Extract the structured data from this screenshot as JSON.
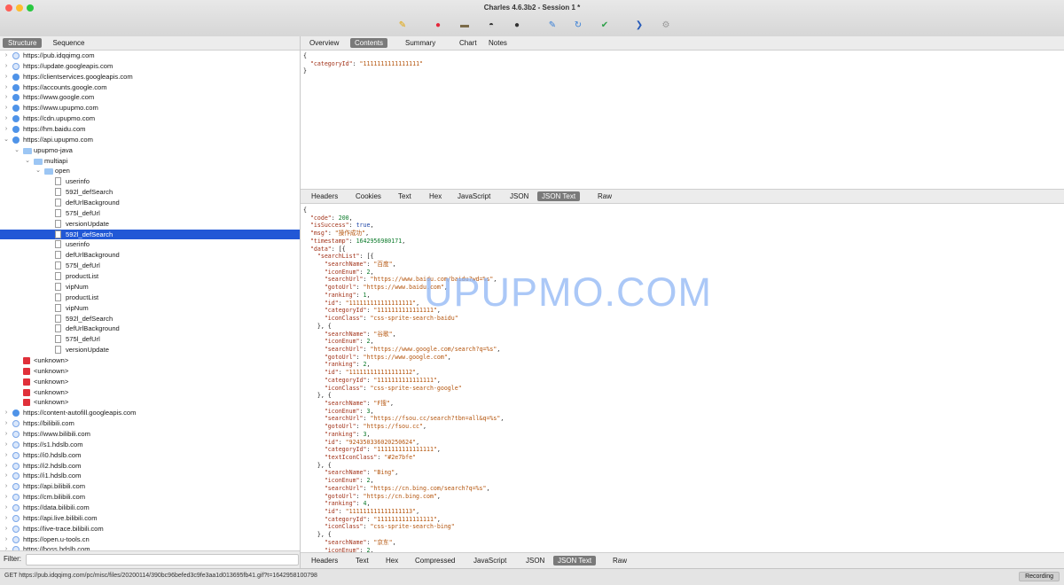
{
  "window": {
    "title": "Charles 4.6.3b2 - Session 1 *"
  },
  "toolbar": [
    {
      "name": "broom-icon",
      "glyph": "✎",
      "color": "#e2a400"
    },
    {
      "name": "record-icon",
      "glyph": "●",
      "color": "#e5273b"
    },
    {
      "name": "throttle-icon",
      "glyph": "▬",
      "color": "#7a6a48"
    },
    {
      "name": "turtle-icon",
      "glyph": "◓",
      "color": "#333333"
    },
    {
      "name": "breakpoint-icon",
      "glyph": "●",
      "color": "#333333"
    },
    {
      "name": "compose-icon",
      "glyph": "✎",
      "color": "#3a80d6"
    },
    {
      "name": "repeat-icon",
      "glyph": "↻",
      "color": "#3a80d6"
    },
    {
      "name": "validate-icon",
      "glyph": "✔",
      "color": "#2fa04a"
    },
    {
      "name": "tools-icon",
      "glyph": "❯",
      "color": "#2559b8"
    },
    {
      "name": "settings-icon",
      "glyph": "⚙",
      "color": "#9a9a9a"
    }
  ],
  "left": {
    "view_tabs": [
      "Structure",
      "Sequence"
    ],
    "filter_label": "Filter:",
    "tree": [
      {
        "caret": "›",
        "icon": "lock",
        "text": "https://pub.idqqimg.com",
        "depth": 0
      },
      {
        "caret": "›",
        "icon": "lock",
        "text": "https://update.googleapis.com",
        "depth": 0
      },
      {
        "caret": "›",
        "icon": "globe",
        "text": "https://clientservices.googleapis.com",
        "depth": 0
      },
      {
        "caret": "›",
        "icon": "globe",
        "text": "https://accounts.google.com",
        "depth": 0
      },
      {
        "caret": "›",
        "icon": "globe",
        "text": "https://www.google.com",
        "depth": 0
      },
      {
        "caret": "›",
        "icon": "globe",
        "text": "https://www.upupmo.com",
        "depth": 0
      },
      {
        "caret": "›",
        "icon": "globe",
        "text": "https://cdn.upupmo.com",
        "depth": 0
      },
      {
        "caret": "›",
        "icon": "globe",
        "text": "https://hm.baidu.com",
        "depth": 0
      },
      {
        "caret": "⌄",
        "icon": "globe",
        "text": "https://api.upupmo.com",
        "depth": 0
      },
      {
        "caret": "⌄",
        "icon": "folder",
        "text": "upupmo-java",
        "depth": 1
      },
      {
        "caret": "⌄",
        "icon": "folder",
        "text": "multiapi",
        "depth": 2
      },
      {
        "caret": "⌄",
        "icon": "folder",
        "text": "open",
        "depth": 3
      },
      {
        "caret": "",
        "icon": "file",
        "text": "userinfo",
        "depth": 4
      },
      {
        "caret": "",
        "icon": "file",
        "text": "592l_defSearch",
        "depth": 4
      },
      {
        "caret": "",
        "icon": "file",
        "text": "defUrlBackground",
        "depth": 4
      },
      {
        "caret": "",
        "icon": "file",
        "text": "575l_defUrl",
        "depth": 4
      },
      {
        "caret": "",
        "icon": "file",
        "text": "versionUpdate",
        "depth": 4
      },
      {
        "caret": "",
        "icon": "file",
        "text": "592l_defSearch",
        "depth": 4,
        "selected": true
      },
      {
        "caret": "",
        "icon": "file",
        "text": "userinfo",
        "depth": 4
      },
      {
        "caret": "",
        "icon": "file",
        "text": "defUrlBackground",
        "depth": 4
      },
      {
        "caret": "",
        "icon": "file",
        "text": "575l_defUrl",
        "depth": 4
      },
      {
        "caret": "",
        "icon": "file",
        "text": "productList",
        "depth": 4
      },
      {
        "caret": "",
        "icon": "file",
        "text": "vipNum",
        "depth": 4
      },
      {
        "caret": "",
        "icon": "file",
        "text": "productList",
        "depth": 4
      },
      {
        "caret": "",
        "icon": "file",
        "text": "vipNum",
        "depth": 4
      },
      {
        "caret": "",
        "icon": "file",
        "text": "592l_defSearch",
        "depth": 4
      },
      {
        "caret": "",
        "icon": "file",
        "text": "defUrlBackground",
        "depth": 4
      },
      {
        "caret": "",
        "icon": "file",
        "text": "575l_defUrl",
        "depth": 4
      },
      {
        "caret": "",
        "icon": "file",
        "text": "versionUpdate",
        "depth": 4
      },
      {
        "caret": "",
        "icon": "err",
        "text": "<unknown>",
        "depth": 1
      },
      {
        "caret": "",
        "icon": "err",
        "text": "<unknown>",
        "depth": 1
      },
      {
        "caret": "",
        "icon": "err",
        "text": "<unknown>",
        "depth": 1
      },
      {
        "caret": "",
        "icon": "err",
        "text": "<unknown>",
        "depth": 1
      },
      {
        "caret": "",
        "icon": "err",
        "text": "<unknown>",
        "depth": 1
      },
      {
        "caret": "›",
        "icon": "globe",
        "text": "https://content-autofill.googleapis.com",
        "depth": 0
      },
      {
        "caret": "›",
        "icon": "lock",
        "text": "https://bilibili.com",
        "depth": 0
      },
      {
        "caret": "›",
        "icon": "lock",
        "text": "https://www.bilibili.com",
        "depth": 0
      },
      {
        "caret": "›",
        "icon": "lock",
        "text": "https://s1.hdslb.com",
        "depth": 0
      },
      {
        "caret": "›",
        "icon": "lock",
        "text": "https://i0.hdslb.com",
        "depth": 0
      },
      {
        "caret": "›",
        "icon": "lock",
        "text": "https://i2.hdslb.com",
        "depth": 0
      },
      {
        "caret": "›",
        "icon": "lock",
        "text": "https://i1.hdslb.com",
        "depth": 0
      },
      {
        "caret": "›",
        "icon": "lock",
        "text": "https://api.bilibili.com",
        "depth": 0
      },
      {
        "caret": "›",
        "icon": "lock",
        "text": "https://cm.bilibili.com",
        "depth": 0
      },
      {
        "caret": "›",
        "icon": "lock",
        "text": "https://data.bilibili.com",
        "depth": 0
      },
      {
        "caret": "›",
        "icon": "lock",
        "text": "https://api.live.bilibili.com",
        "depth": 0
      },
      {
        "caret": "›",
        "icon": "lock",
        "text": "https://live-trace.bilibili.com",
        "depth": 0
      },
      {
        "caret": "›",
        "icon": "lock",
        "text": "https://open.u-tools.cn",
        "depth": 0
      },
      {
        "caret": "›",
        "icon": "lock",
        "text": "https://boss.hdslb.com",
        "depth": 0
      }
    ]
  },
  "right": {
    "top_tabs": [
      {
        "label": "Overview",
        "active": false
      },
      {
        "label": "Contents",
        "active": true
      },
      {
        "label": "Summary",
        "active": false
      },
      {
        "label": "Chart",
        "active": false
      },
      {
        "label": "Notes",
        "active": false
      }
    ],
    "request_tabs": [
      {
        "label": "Headers",
        "active": false
      },
      {
        "label": "Cookies",
        "active": false
      },
      {
        "label": "Text",
        "active": false
      },
      {
        "label": "Hex",
        "active": false
      },
      {
        "label": "JavaScript",
        "active": false
      },
      {
        "label": "JSON",
        "active": false
      },
      {
        "label": "JSON Text",
        "active": true
      },
      {
        "label": "Raw",
        "active": false
      }
    ],
    "response_tabs": [
      {
        "label": "Headers",
        "active": false
      },
      {
        "label": "Text",
        "active": false
      },
      {
        "label": "Hex",
        "active": false
      },
      {
        "label": "Compressed",
        "active": false
      },
      {
        "label": "JavaScript",
        "active": false
      },
      {
        "label": "JSON",
        "active": false
      },
      {
        "label": "JSON Text",
        "active": true
      },
      {
        "label": "Raw",
        "active": false
      }
    ],
    "request_body": [
      "{",
      "  \"categoryId\": \"1111111111111111\"",
      "}"
    ],
    "response_body": [
      "{",
      "  \"code\": 200,",
      "  \"isSuccess\": true,",
      "  \"msg\": \"操作成功\",",
      "  \"timestamp\": 1642956980171,",
      "  \"data\": [{",
      "    \"searchList\": [{",
      "      \"searchName\": \"百度\",",
      "      \"iconEnum\": 2,",
      "      \"searchUrl\": \"https://www.baidu.com/baidu?wd=%s\",",
      "      \"gotoUrl\": \"https://www.baidu.com\",",
      "      \"ranking\": 1,",
      "      \"id\": \"111111111111111111\",",
      "      \"categoryId\": \"1111111111111111\",",
      "      \"iconClass\": \"css-sprite-search-baidu\"",
      "    }, {",
      "      \"searchName\": \"谷歌\",",
      "      \"iconEnum\": 2,",
      "      \"searchUrl\": \"https://www.google.com/search?q=%s\",",
      "      \"gotoUrl\": \"https://www.google.com\",",
      "      \"ranking\": 2,",
      "      \"id\": \"111111111111111112\",",
      "      \"categoryId\": \"1111111111111111\",",
      "      \"iconClass\": \"css-sprite-search-google\"",
      "    }, {",
      "      \"searchName\": \"F搜\",",
      "      \"iconEnum\": 3,",
      "      \"searchUrl\": \"https://fsou.cc/search?tbn=all&q=%s\",",
      "      \"gotoUrl\": \"https://fsou.cc\",",
      "      \"ranking\": 3,",
      "      \"id\": \"924350336020250624\",",
      "      \"categoryId\": \"1111111111111111\",",
      "      \"textIconClass\": \"#2e7bfe\"",
      "    }, {",
      "      \"searchName\": \"Bing\",",
      "      \"iconEnum\": 2,",
      "      \"searchUrl\": \"https://cn.bing.com/search?q=%s\",",
      "      \"gotoUrl\": \"https://cn.bing.com\",",
      "      \"ranking\": 4,",
      "      \"id\": \"111111111111111113\",",
      "      \"categoryId\": \"1111111111111111\",",
      "      \"iconClass\": \"css-sprite-search-bing\"",
      "    }, {",
      "      \"searchName\": \"京东\",",
      "      \"iconEnum\": 2,"
    ],
    "watermark": "UPUPMO.COM"
  },
  "status": {
    "request_line": "GET https://pub.idqqimg.com/pc/misc/files/20200114/390bc96befed3c9fe3aa1d013695fb41.gif?t=1642958100798",
    "recording": "Recording"
  }
}
